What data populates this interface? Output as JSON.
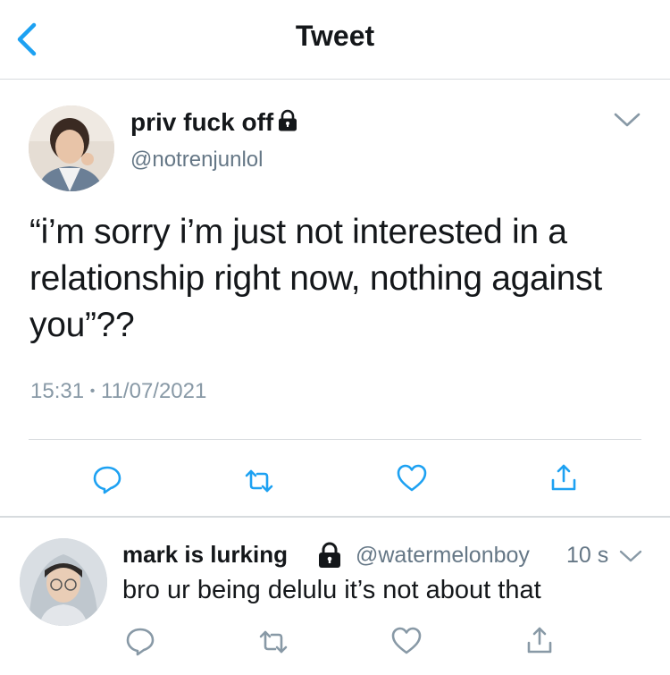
{
  "header": {
    "title": "Tweet",
    "back_icon": "chevron-left-icon",
    "accent": "#1da1f2"
  },
  "tweet": {
    "display_name": "priv fuck off",
    "handle": "@notrenjunlol",
    "text": "“i’m sorry i’m just not interested in a relationship right now, nothing against you”??",
    "time": "15:31",
    "separator": "•",
    "date": "11/07/2021",
    "actions": [
      "reply-icon",
      "retweet-icon",
      "like-icon",
      "share-icon"
    ]
  },
  "reply": {
    "display_name": "mark is lurking",
    "handle": "@watermelonboy",
    "time": "10 s",
    "text": "bro ur being delulu it’s not about that",
    "actions": [
      "reply-icon",
      "retweet-icon",
      "like-icon",
      "share-icon"
    ]
  },
  "colors": {
    "text": "#14171a",
    "secondary": "#657786",
    "icon": "#1da1f2",
    "divider": "#d7dbde"
  }
}
